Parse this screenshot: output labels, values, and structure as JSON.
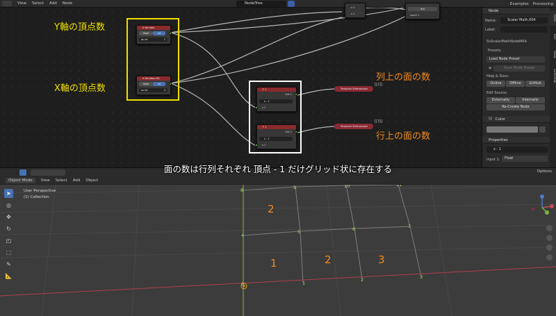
{
  "node_editor": {
    "header": {
      "menu": [
        "View",
        "Select",
        "Add",
        "Node"
      ],
      "tree_name": "NodeTree",
      "right": [
        "Examples",
        "Processing"
      ]
    },
    "nodes": {
      "y_number": {
        "title": "A Number",
        "mode_left": "float",
        "mode_right": "int",
        "field": "as int",
        "value": "1"
      },
      "x_number": {
        "title": "A Number.001",
        "mode_left": "float",
        "mode_right": "int",
        "field": "as int",
        "value": "4"
      },
      "formula_1": {
        "title": "F 1",
        "out": "Out 1",
        "expr": "x - 1",
        "input": "x 1"
      },
      "formula_2": {
        "title": "F 1",
        "out": "Out 1",
        "expr": "x - 1",
        "input": "x 1"
      },
      "viewer_1": {
        "title": "Temporal Stethoscope",
        "value": "[[2]]"
      },
      "viewer_2": {
        "title": "Temporal Stethoscope",
        "value": "[[3]]"
      },
      "math_top": {
        "row1": "x 1",
        "row2": "x 1"
      },
      "math_right": {
        "row1": "mul",
        "row2": "count 1"
      }
    },
    "annotations": {
      "y_count": "Y軸の頂点数",
      "x_count": "X軸の頂点数",
      "faces_col": "列上の面の数",
      "faces_row": "行上の面の数"
    }
  },
  "npanel": {
    "section_node": "Node",
    "name_label": "Name:",
    "name_value": "Scalar Math.004",
    "label_label": "Label:",
    "node_type": "SvScalarMathNodeMK4",
    "presets_label": "Presets:",
    "load_preset": "Load Node Preset",
    "save_preset": "Save Node Preset",
    "help_label": "Help & Docs:",
    "help_buttons": [
      "Online",
      "Offline",
      "GitHub"
    ],
    "edit_label": "Edit Source:",
    "edit_buttons": [
      "Externally",
      "Internally"
    ],
    "recreate": "Re-Create Node",
    "color_label": "Color",
    "properties_label": "Properties",
    "function_value": "x - 1",
    "input_label": "Input 1:",
    "input_value": "Float",
    "tabs": [
      "Item",
      "Tool",
      "View",
      "Sverchok"
    ]
  },
  "caption": "面の数は行列それぞれ 頂点 - 1 だけグリッド状に存在する",
  "viewport": {
    "mode": "Object Mode",
    "menu": [
      "View",
      "Select",
      "Add",
      "Object"
    ],
    "options": "Options",
    "perspective": "User Perspective",
    "collection": "(1) Collection",
    "vertex_labels": [
      "0",
      "1",
      "2",
      "3",
      "4",
      "5",
      "6",
      "7",
      "8",
      "9",
      "10",
      "11"
    ],
    "face_labels": [
      "1",
      "2",
      "3",
      "2"
    ]
  }
}
